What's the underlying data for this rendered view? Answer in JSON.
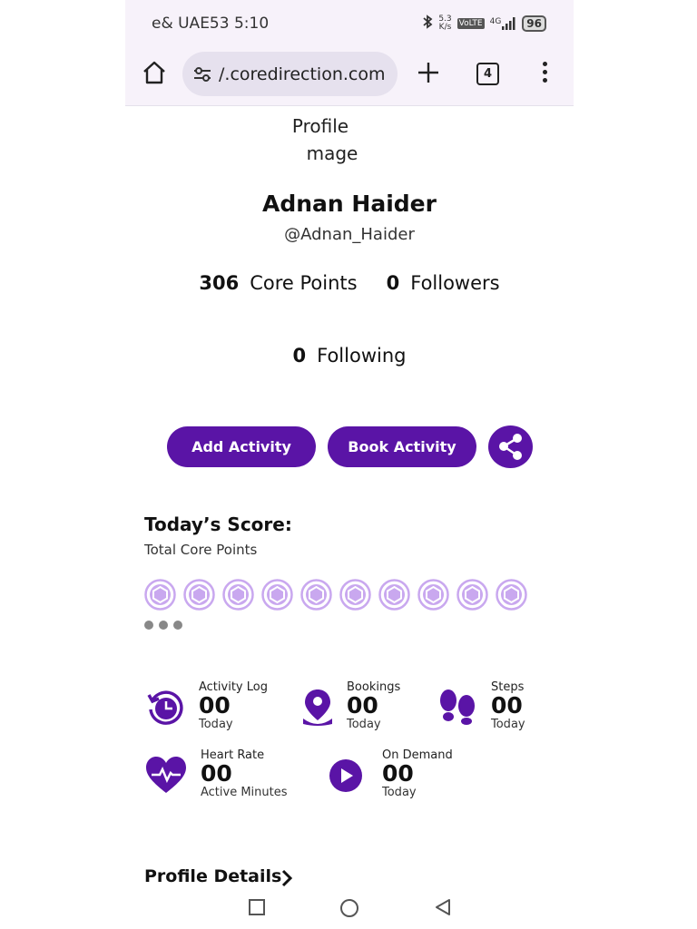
{
  "status_bar": {
    "carrier_time": "e& UAE53 5:10",
    "net_speed_top": "5.3",
    "net_speed_bottom": "K/s",
    "volte": "VoLTE",
    "network": "4G",
    "battery": "96"
  },
  "browser": {
    "url": "/.coredirection.com",
    "tab_count": "4"
  },
  "profile": {
    "image_alt_line1": "Profile",
    "image_alt_line2": "mage",
    "name": "Adnan Haider",
    "handle": "@Adnan_Haider",
    "core_points_value": "306",
    "core_points_label": "Core Points",
    "followers_value": "0",
    "followers_label": "Followers",
    "following_value": "0",
    "following_label": "Following"
  },
  "actions": {
    "add_activity": "Add Activity",
    "book_activity": "Book Activity"
  },
  "score": {
    "title": "Today’s Score:",
    "subtitle": "Total Core Points",
    "coin_count": 10
  },
  "metrics": [
    {
      "label": "Activity Log",
      "value": "00",
      "sub": "Today",
      "icon": "activity-log-icon"
    },
    {
      "label": "Bookings",
      "value": "00",
      "sub": "Today",
      "icon": "location-pin-icon"
    },
    {
      "label": "Steps",
      "value": "00",
      "sub": "Today",
      "icon": "footprints-icon"
    },
    {
      "label": "Heart Rate",
      "value": "00",
      "sub": "Active Minutes",
      "icon": "heart-rate-icon"
    },
    {
      "label": "On Demand",
      "value": "00",
      "sub": "Today",
      "icon": "play-icon"
    }
  ],
  "profile_details": "Profile Details",
  "colors": {
    "brand": "#5a14a6",
    "coin": "#c9a8ef"
  }
}
